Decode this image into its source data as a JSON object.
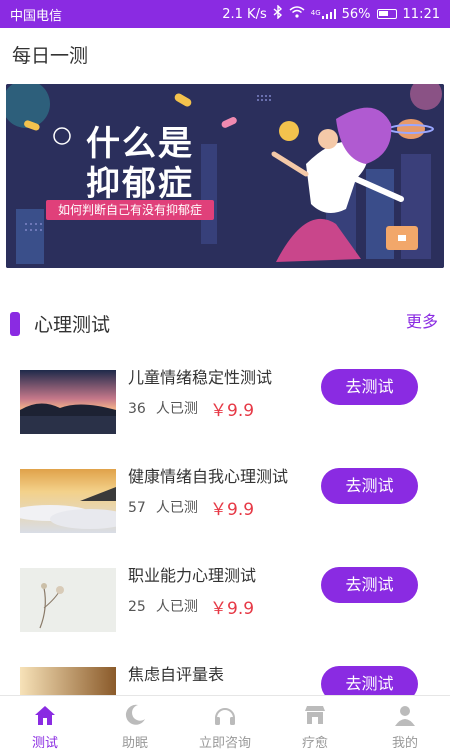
{
  "status_bar": {
    "carrier": "中国电信",
    "speed": "2.1 K/s",
    "network": "4G",
    "battery": "56%",
    "time": "11:21",
    "icons": [
      "bluetooth-icon",
      "wifi-icon",
      "signal-icon",
      "battery-icon"
    ]
  },
  "header": {
    "title": "每日一测"
  },
  "banner": {
    "title_line1": "什么是",
    "title_line2": "抑郁症",
    "subtitle": "如何判断自己有没有抑郁症"
  },
  "section": {
    "title": "心理测试",
    "more_label": "更多"
  },
  "tests": [
    {
      "title": "儿童情绪稳定性测试",
      "count": "36",
      "count_label": "人已测",
      "price": "￥9.9",
      "button": "去测试",
      "thumb": "lake-sunset"
    },
    {
      "title": "健康情绪自我心理测试",
      "count": "57",
      "count_label": "人已测",
      "price": "￥9.9",
      "button": "去测试",
      "thumb": "sea-of-clouds"
    },
    {
      "title": "职业能力心理测试",
      "count": "25",
      "count_label": "人已测",
      "price": "￥9.9",
      "button": "去测试",
      "thumb": "dried-flowers"
    },
    {
      "title": "焦虑自评量表",
      "count": "",
      "count_label": "",
      "price": "",
      "button": "去测试",
      "thumb": "warm-light"
    }
  ],
  "tabbar": [
    {
      "label": "测试",
      "icon": "home-icon",
      "active": true
    },
    {
      "label": "助眠",
      "icon": "moon-icon",
      "active": false
    },
    {
      "label": "立即咨询",
      "icon": "headphones-icon",
      "active": false
    },
    {
      "label": "疗愈",
      "icon": "shop-icon",
      "active": false
    },
    {
      "label": "我的",
      "icon": "profile-icon",
      "active": false
    }
  ],
  "colors": {
    "accent": "#8a2be2",
    "price": "#e63946",
    "banner_bg": "#2b2f5c"
  }
}
